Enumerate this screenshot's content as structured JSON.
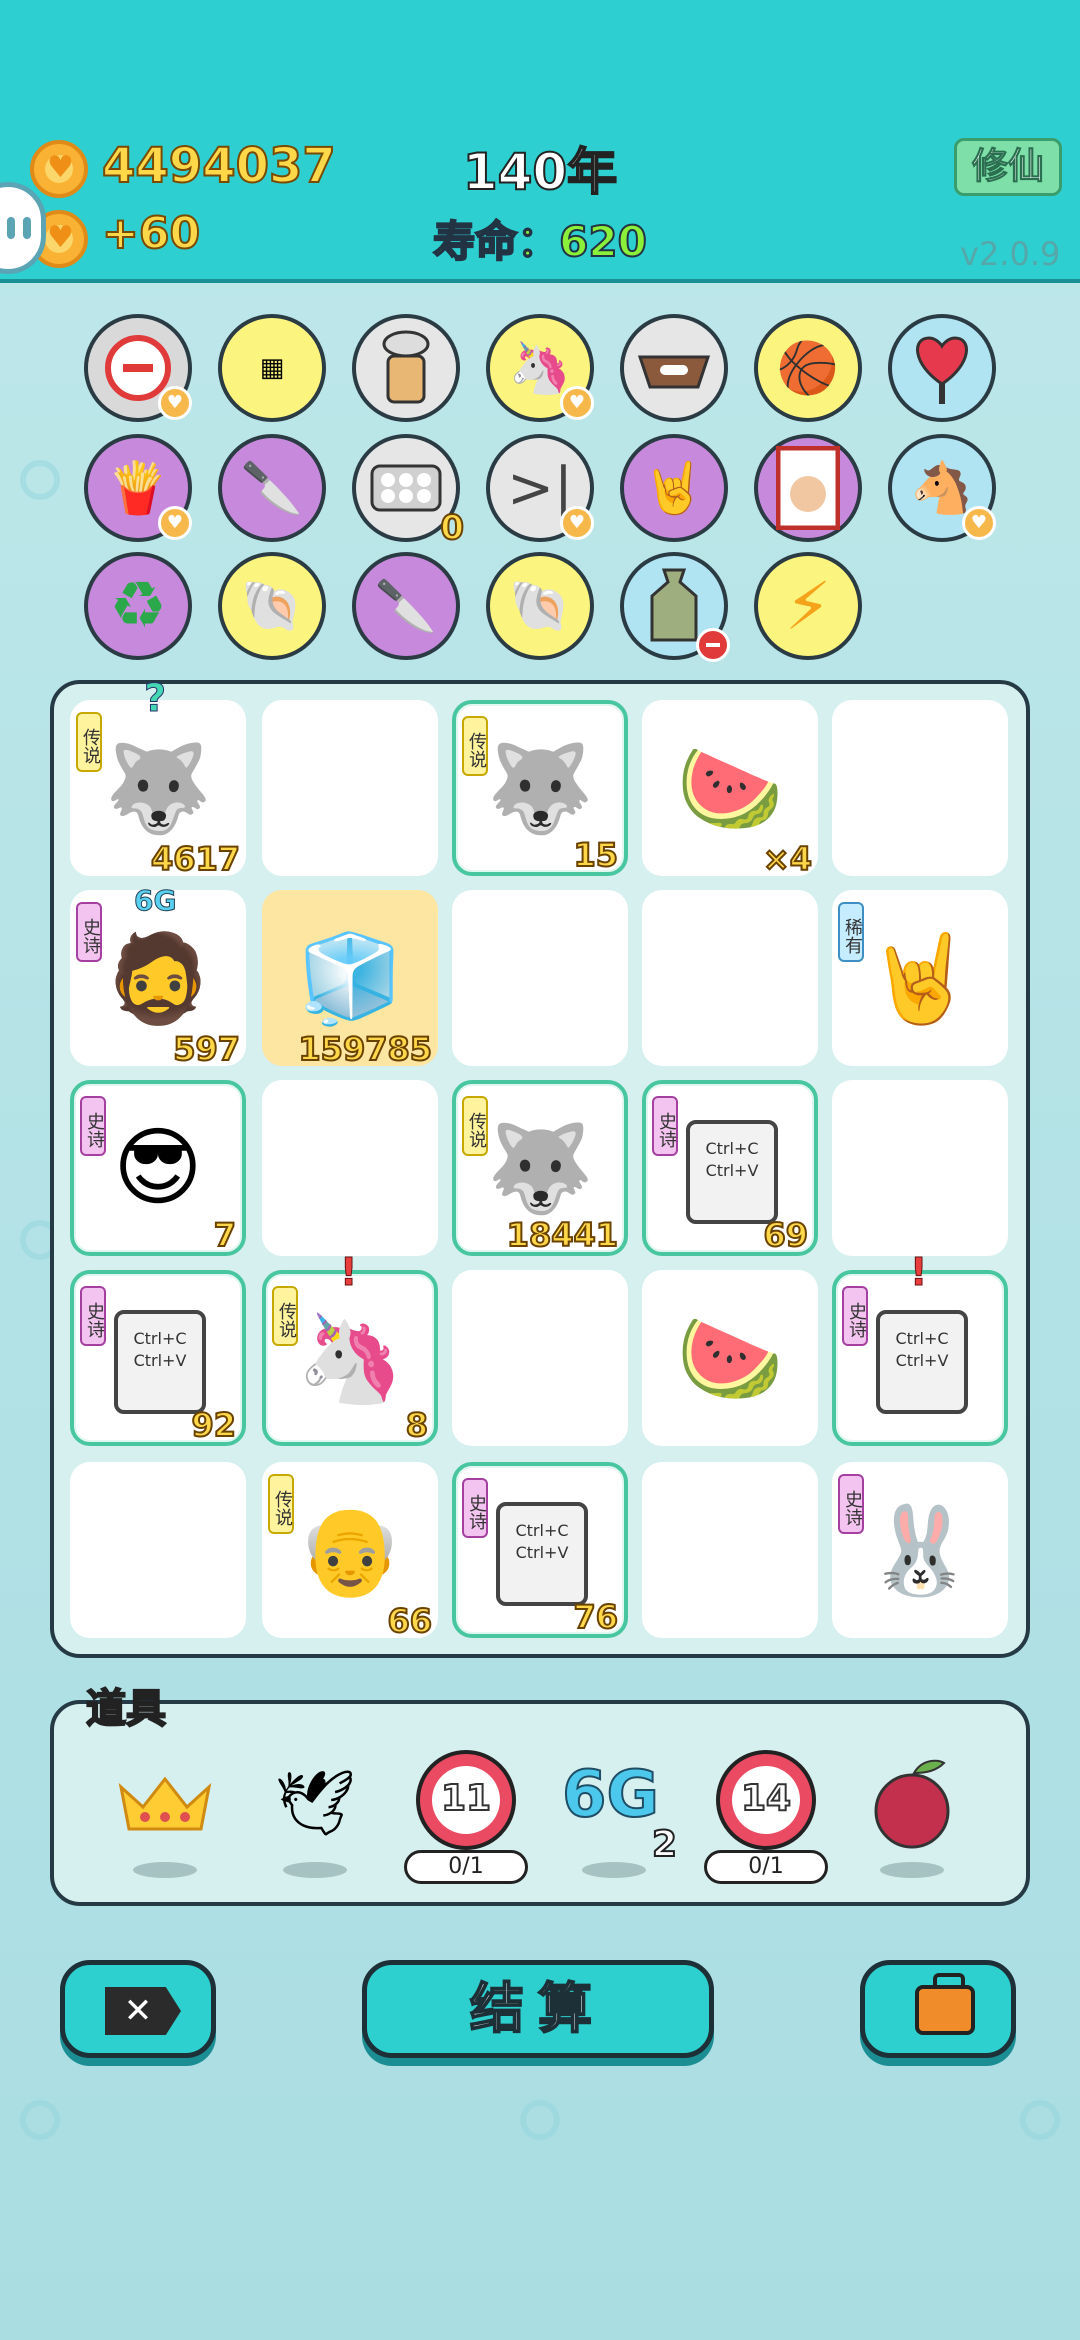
{
  "header": {
    "coins": "4494037",
    "coin_gain": "+60",
    "year": "140年",
    "life": "寿命：620",
    "xiuxian_label": "修仙",
    "version": "v2.0.9"
  },
  "colors": {
    "header_bg": "#2dcfd0",
    "board_bg": "#d6efef",
    "highlight_border": "#47c6a0",
    "gold_number": "#ffd84a"
  },
  "collected_items": [
    {
      "name": "minus-sign-icon"
    },
    {
      "name": "wang-tiles-icon"
    },
    {
      "name": "bubble-tea-icon"
    },
    {
      "name": "unicorn-icon"
    },
    {
      "name": "dog-food-bowl-icon"
    },
    {
      "name": "basketballs-icon"
    },
    {
      "name": "heart-sign-icon"
    },
    {
      "name": "french-fries-icon"
    },
    {
      "name": "cleaver-icon"
    },
    {
      "name": "egg-tray-icon",
      "count": "0"
    },
    {
      "name": "skip-icon"
    },
    {
      "name": "rock-hand-icon"
    },
    {
      "name": "time-magazine-icon"
    },
    {
      "name": "horse-couple-icon"
    },
    {
      "name": "recycle-icon"
    },
    {
      "name": "shell-icon"
    },
    {
      "name": "cleaver-icon"
    },
    {
      "name": "shell-icon"
    },
    {
      "name": "trash-bag-icon"
    },
    {
      "name": "lightning-icon"
    }
  ],
  "board": {
    "tags": {
      "legend": "传说",
      "epic": "史诗",
      "rare": "稀有"
    },
    "cells": [
      {
        "tag": "传说",
        "value": "4617",
        "mark": "?"
      },
      {},
      {
        "tag": "传说",
        "value": "15"
      },
      {
        "value": "×4"
      },
      {},
      {
        "tag": "史诗",
        "value": "597",
        "mark": "6G"
      },
      {
        "value": "159785"
      },
      {},
      {},
      {
        "tag": "稀有"
      },
      {
        "tag": "史诗",
        "value": "7"
      },
      {},
      {
        "tag": "传说",
        "value": "18441"
      },
      {
        "tag": "史诗",
        "value": "69",
        "ctrl1": "Ctrl+C",
        "ctrl2": "Ctrl+V"
      },
      {},
      {
        "tag": "史诗",
        "value": "92",
        "ctrl1": "Ctrl+C",
        "ctrl2": "Ctrl+V"
      },
      {
        "tag": "传说",
        "value": "8",
        "mark": "!"
      },
      {},
      {},
      {
        "tag": "史诗",
        "mark": "!",
        "ctrl1": "Ctrl+C",
        "ctrl2": "Ctrl+V"
      },
      {},
      {
        "tag": "传说",
        "value": "66"
      },
      {
        "tag": "史诗",
        "value": "76",
        "ctrl1": "Ctrl+C",
        "ctrl2": "Ctrl+V"
      },
      {},
      {
        "tag": "史诗"
      }
    ]
  },
  "props": {
    "label": "道具",
    "target1": "11",
    "target1_uses": "0/1",
    "sixg": "6G",
    "sixg_count": "2",
    "target2": "14",
    "target2_uses": "0/1"
  },
  "buttons": {
    "close": "✕",
    "settle": "结算"
  }
}
